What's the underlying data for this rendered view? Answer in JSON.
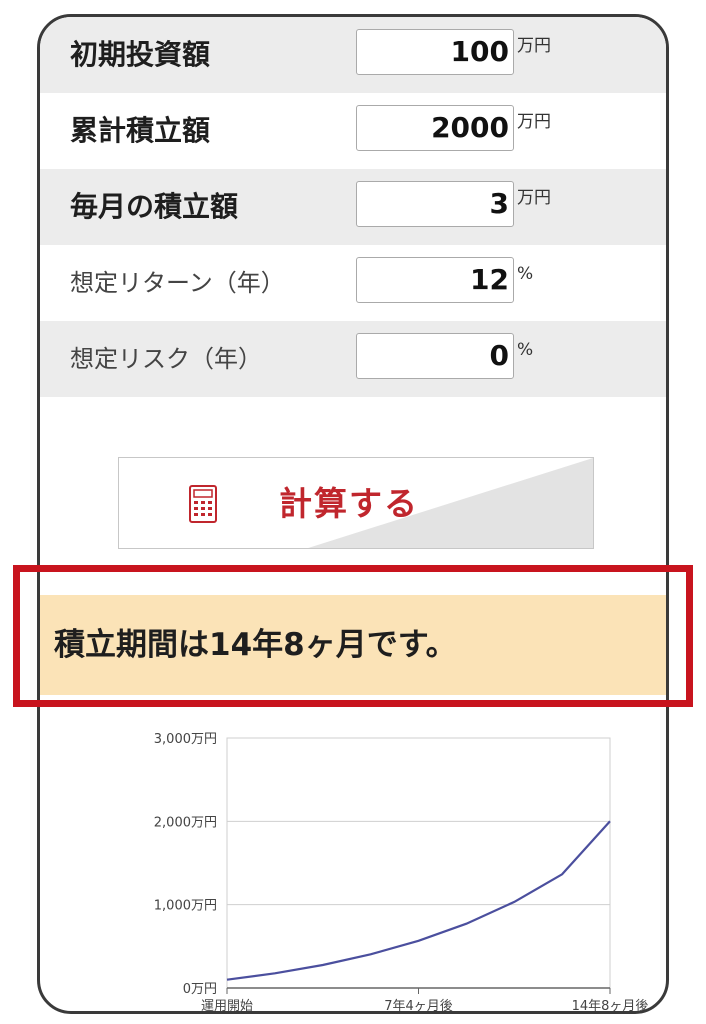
{
  "form": {
    "rows": [
      {
        "label": "初期投資額",
        "value": "100",
        "unit": "万円"
      },
      {
        "label": "累計積立額",
        "value": "2000",
        "unit": "万円"
      },
      {
        "label": "毎月の積立額",
        "value": "3",
        "unit": "万円"
      },
      {
        "label": "想定リターン（年）",
        "value": "12",
        "unit": "%"
      },
      {
        "label": "想定リスク（年）",
        "value": "0",
        "unit": "%"
      }
    ]
  },
  "calculate_button": {
    "label": "計算する",
    "icon": "calculator-icon"
  },
  "result": {
    "text": "積立期間は14年8ヶ月です。"
  },
  "colors": {
    "accent": "#c0262d",
    "result_bg": "#fbe3b7",
    "highlight": "#c8141e",
    "line": "#4b4f9e"
  },
  "chart_data": {
    "type": "line",
    "y_ticks": [
      "3,000万円",
      "2,000万円",
      "1,000万円",
      "0万円"
    ],
    "y_tick_values": [
      3000,
      2000,
      1000,
      0
    ],
    "x_ticks": [
      "運用開始",
      "7年4ヶ月後",
      "14年8ヶ月後"
    ],
    "ylim": [
      0,
      3000
    ],
    "xlim_months": [
      0,
      176
    ],
    "grid": true,
    "series": [
      {
        "points": [
          [
            0,
            100
          ],
          [
            22,
            177
          ],
          [
            44,
            276
          ],
          [
            66,
            404
          ],
          [
            88,
            566
          ],
          [
            110,
            772
          ],
          [
            132,
            1033
          ],
          [
            154,
            1365
          ],
          [
            176,
            2000
          ]
        ]
      }
    ]
  }
}
